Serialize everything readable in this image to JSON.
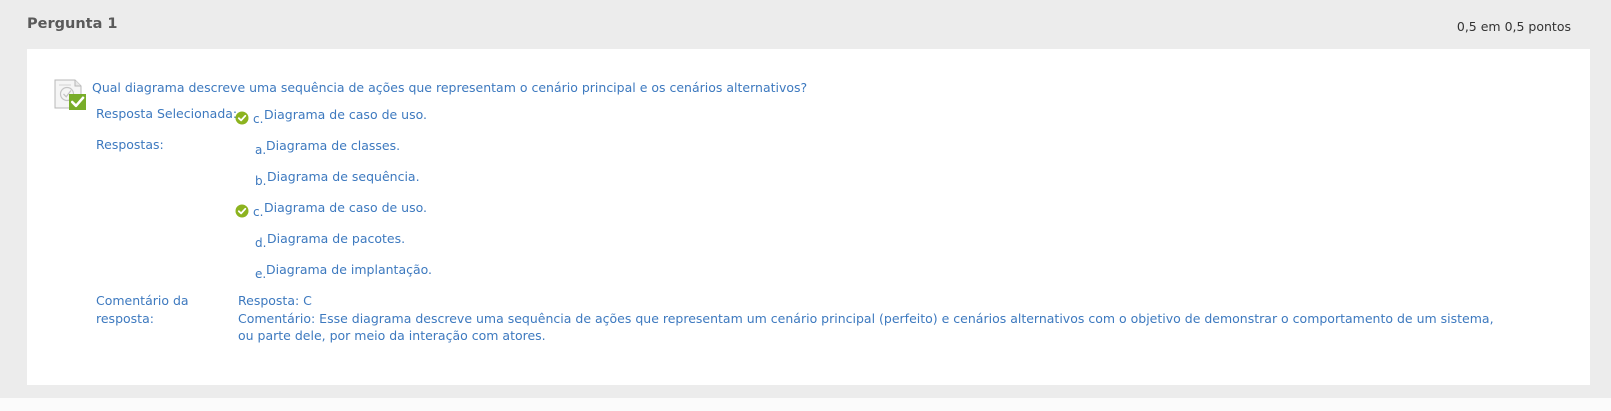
{
  "header": {
    "title": "Pergunta 1",
    "points": "0,5 em 0,5 pontos"
  },
  "question": {
    "text": "Qual diagrama descreve uma sequência de ações que representam o cenário principal e os cenários alternativos?",
    "status_icon": "correct-answer-icon"
  },
  "selected": {
    "label": "Resposta Selecionada:",
    "letter": "c.",
    "text": "Diagrama de caso de uso.",
    "icon": "check-circle-icon"
  },
  "answers": {
    "label": "Respostas:",
    "options": [
      {
        "letter": "a.",
        "text": "Diagrama de classes.",
        "correct": false
      },
      {
        "letter": "b.",
        "text": "Diagrama de sequência.",
        "correct": false
      },
      {
        "letter": "c.",
        "text": "Diagrama de caso de uso.",
        "correct": true
      },
      {
        "letter": "d.",
        "text": "Diagrama de pacotes.",
        "correct": false
      },
      {
        "letter": "e.",
        "text": "Diagrama de implantação.",
        "correct": false
      }
    ]
  },
  "feedback": {
    "label_line1": "Comentário da",
    "label_line2": "resposta:",
    "answer": "Resposta: C",
    "comment": "Comentário: Esse diagrama descreve uma sequência de ações que representam um cenário principal (perfeito) e cenários alternativos com o objetivo de demonstrar o comportamento de um sistema, ou parte dele, por meio da interação com atores."
  },
  "colors": {
    "text_blue": "#3d79bf",
    "check_green": "#8cb31f",
    "page_bg": "#ececec",
    "card_bg": "#ffffff"
  }
}
